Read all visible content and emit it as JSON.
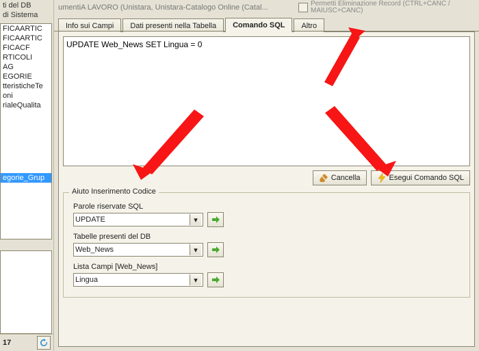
{
  "left": {
    "header1": "ti del DB",
    "header2": "di Sistema",
    "items": [
      "FICAARTIC",
      "FICAARTIC",
      "FICACF",
      "RTICOLI",
      "AG",
      "EGORIE",
      "tteristicheTe",
      "oni",
      "rialeQualita"
    ],
    "selected": "egorie_Grup",
    "footer_num": "17"
  },
  "top": {
    "left_fragment": "umentiA    LAVORO (Unistara, Unistara-Catalogo Online (Catal...",
    "checkbox_label": "Permetti Eliminazione Record (CTRL+CANC / MAIUSC+CANC)"
  },
  "tabs": {
    "t1": "Info sui Campi",
    "t2": "Dati presenti nella Tabella",
    "t3": "Comando SQL",
    "t4": "Altro"
  },
  "sql_text": "UPDATE Web_News SET Lingua = 0",
  "buttons": {
    "clear": "Cancella",
    "run": "Esegui Comando SQL"
  },
  "helper": {
    "legend": "Aiuto Inserimento Codice",
    "reserved_label": "Parole riservate SQL",
    "reserved_value": "UPDATE",
    "tables_label": "Tabelle presenti del DB",
    "tables_value": "Web_News",
    "fields_label": "Lista Campi [Web_News]",
    "fields_value": "Lingua"
  }
}
